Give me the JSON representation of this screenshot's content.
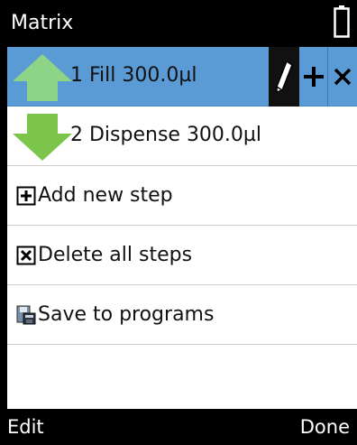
{
  "window": {
    "title": "Matrix"
  },
  "steps": [
    {
      "label": "1  Fill 300.0µl",
      "direction": "up",
      "icon": "arrow-up-icon",
      "color": "#8ed486"
    },
    {
      "label": "2  Dispense 300.0µl",
      "direction": "down",
      "icon": "arrow-down-icon",
      "color": "#7bc64a"
    }
  ],
  "step_actions": {
    "edit_icon": "pencil-icon",
    "add_icon": "plus-icon",
    "delete_icon": "close-icon"
  },
  "menu": [
    {
      "label": "Add new step",
      "icon": "plus-box-icon"
    },
    {
      "label": "Delete all steps",
      "icon": "x-box-icon"
    },
    {
      "label": "Save to programs",
      "icon": "floppy-save-icon"
    }
  ],
  "softkeys": {
    "left": "Edit",
    "right": "Done"
  },
  "colors": {
    "selection": "#5b9bd5",
    "bars": "#000000"
  }
}
